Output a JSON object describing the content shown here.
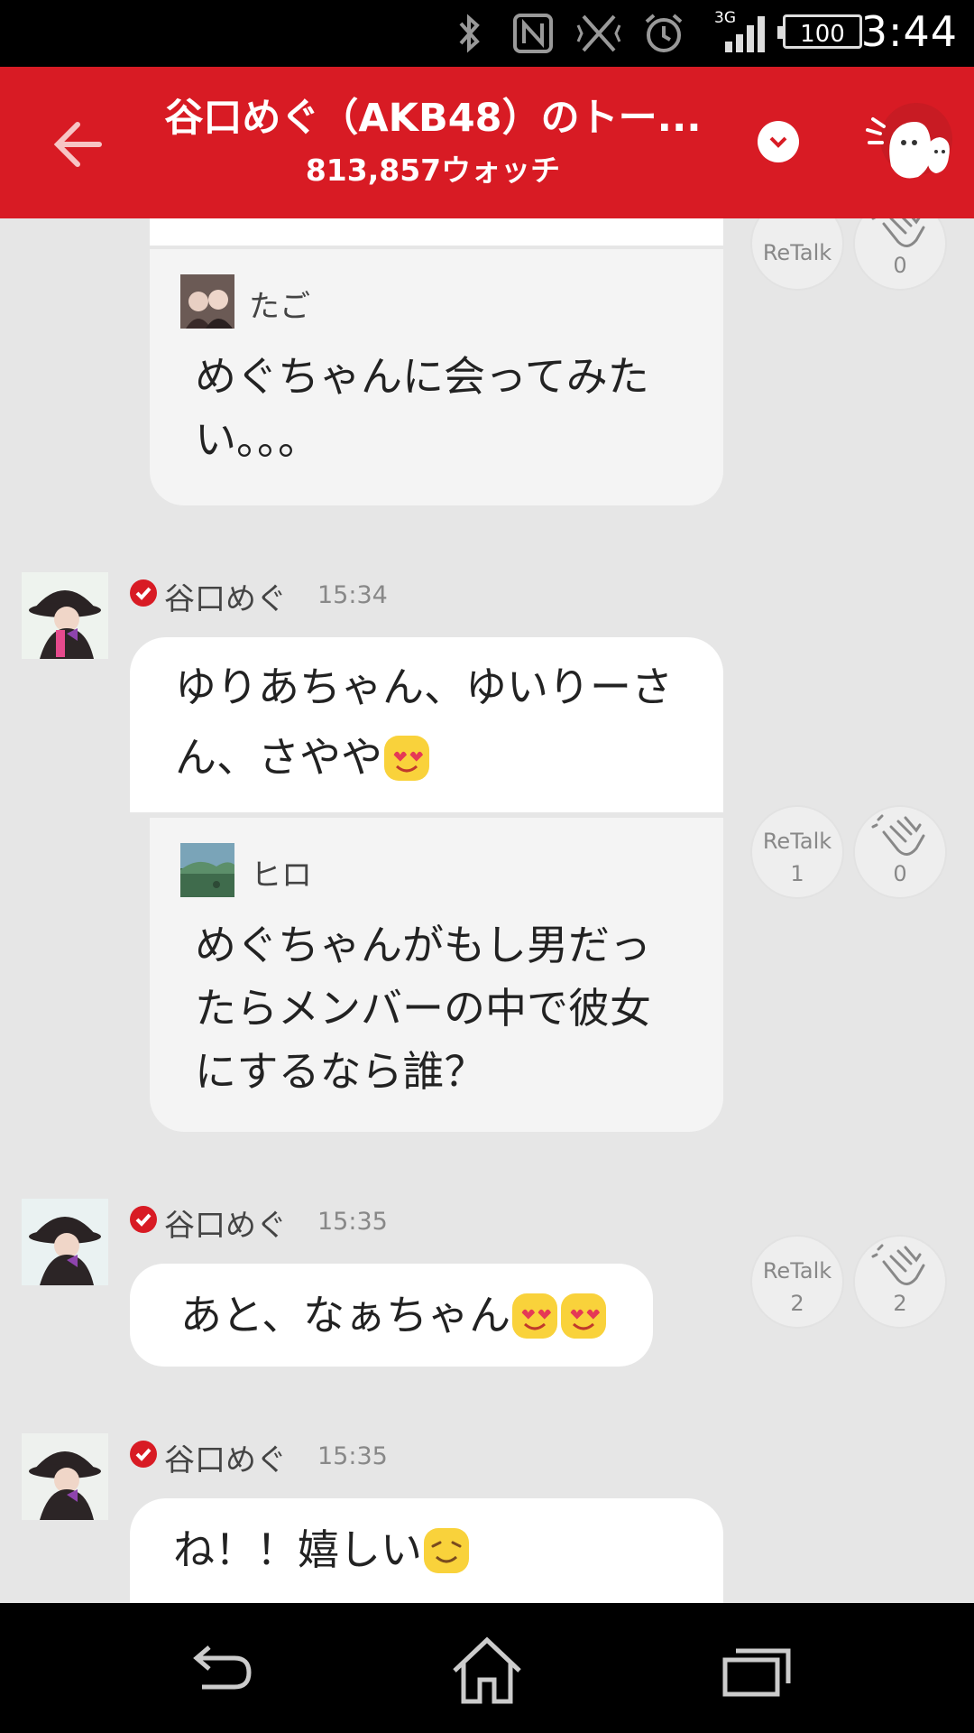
{
  "status_bar": {
    "time": "3:44",
    "battery": "100",
    "network": "3G",
    "icons": [
      "bluetooth-icon",
      "nfc-icon",
      "vibrate-off-icon",
      "alarm-icon",
      "signal-icon",
      "battery-icon"
    ]
  },
  "header": {
    "title": "谷口めぐ（AKB48）のトー...",
    "subtitle": "813,857ウォッチ",
    "color": "#d81b24"
  },
  "messages": [
    {
      "reply": {
        "name": "たご",
        "text_line1": "めぐちゃんに会ってみた",
        "text_line2": "い。。。"
      },
      "retalk_label": "ReTalk",
      "clap_count": "0"
    },
    {
      "sender": "谷口めぐ",
      "time": "15:34",
      "text_line1": "ゆりあちゃん、ゆいりーさ",
      "text_line2": "ん、さやや",
      "reply": {
        "name": "ヒロ",
        "text_line1": "めぐちゃんがもし男だっ",
        "text_line2": "たらメンバーの中で彼女",
        "text_line3": "にするなら誰？"
      },
      "retalk_label": "ReTalk",
      "retalk_count": "1",
      "clap_count": "0"
    },
    {
      "sender": "谷口めぐ",
      "time": "15:35",
      "text": "あと、なぁちゃん",
      "retalk_label": "ReTalk",
      "retalk_count": "2",
      "clap_count": "2"
    },
    {
      "sender": "谷口めぐ",
      "time": "15:35",
      "text": "ね！！嬉しい"
    }
  ]
}
